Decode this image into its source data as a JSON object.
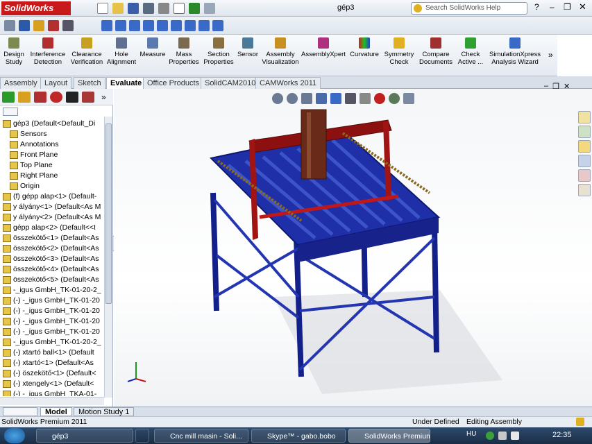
{
  "app": {
    "logo": "SolidWorks",
    "doc_title": "gép3"
  },
  "search": {
    "placeholder": "Search SolidWorks Help"
  },
  "commands": [
    {
      "label": "Design Study"
    },
    {
      "label": "Interference Detection"
    },
    {
      "label": "Clearance Verification"
    },
    {
      "label": "Hole Alignment"
    },
    {
      "label": "Measure"
    },
    {
      "label": "Mass Properties"
    },
    {
      "label": "Section Properties"
    },
    {
      "label": "Sensor"
    },
    {
      "label": "Assembly Visualization"
    },
    {
      "label": "AssemblyXpert"
    },
    {
      "label": "Curvature"
    },
    {
      "label": "Symmetry Check"
    },
    {
      "label": "Compare Documents"
    },
    {
      "label": "Check Active ..."
    },
    {
      "label": "SimulationXpress Analysis Wizard"
    }
  ],
  "tabs": [
    "Assembly",
    "Layout",
    "Sketch",
    "Evaluate",
    "Office Products",
    "SolidCAM2010",
    "CAMWorks 2011"
  ],
  "active_tab": "Evaluate",
  "tree": [
    "gép3  (Default<Default_Di",
    "Sensors",
    "Annotations",
    "Front Plane",
    "Top Plane",
    "Right Plane",
    "Origin",
    "(f) gépp alap<1> (Default-",
    "y ályány<1> (Default<As M",
    "y ályány<2> (Default<As M",
    "gépp alap<2> (Default<<I",
    "összekötő<1> (Default<As",
    "összekötő<2> (Default<As",
    "összekötő<3> (Default<As",
    "összekötő<4> (Default<As",
    "összekötő<5> (Default<As",
    "-_igus GmbH_TK-01-20-2_",
    "(-) -_igus GmbH_TK-01-20",
    "(-) -_igus GmbH_TK-01-20",
    "(-) -_igus GmbH_TK-01-20",
    "(-) -_igus GmbH_TK-01-20",
    "-_igus GmbH_TK-01-20-2_",
    "(-) xtartó ball<1> (Default",
    "(-) xtartó<1> (Default<As",
    "(-) öszekötő<1> (Default<",
    "(-) xtengely<1> (Default<",
    "(-) -_igus GmbH_TKA-01-"
  ],
  "bottom_tabs": [
    "Model",
    "Motion Study 1"
  ],
  "status": {
    "product": "SolidWorks Premium 2011",
    "state": "Under Defined",
    "mode": "Editing Assembly"
  },
  "taskbar": {
    "items": [
      "gép3",
      "Cnc mill masin - Soli...",
      "Skype™ - gabo.bobo",
      "SolidWorks Premium..."
    ],
    "lang": "HU",
    "clock": "22:35"
  },
  "colors": {
    "frame_blue": "#1b2fa0",
    "gantry_red": "#8c1010",
    "accent": "#c81a1a"
  }
}
